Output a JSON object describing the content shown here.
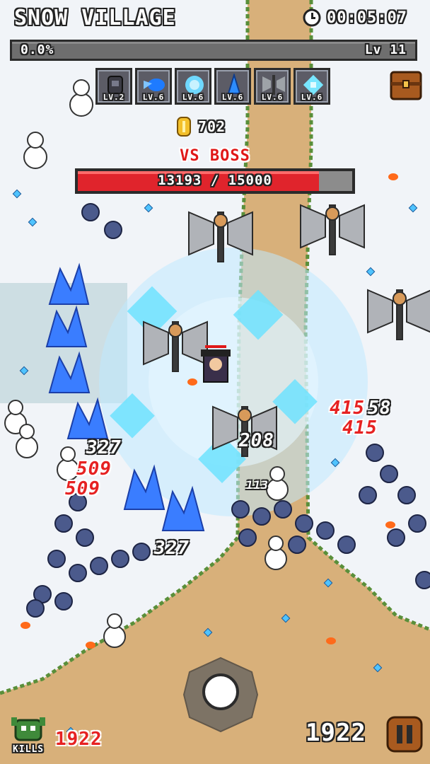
{
  "hud": {
    "stage_title": "SNOW VILLAGE",
    "timer": "00:05:07",
    "xp_percent_text": "0.0%",
    "xp_fraction": 0.0,
    "level_text": "Lv 11",
    "coins": "702",
    "boss_label": "VS BOSS",
    "boss_hp_text": "13193 / 15000",
    "boss_hp_fraction": 0.8795,
    "kills_label": "KILLS",
    "kills_count": "1922",
    "score": "1922"
  },
  "skills": [
    {
      "icon": "armor-icon",
      "level": "LV.2",
      "color": "#3b3b44"
    },
    {
      "icon": "fireball-icon",
      "level": "LV.6",
      "color": "#1e7bff"
    },
    {
      "icon": "ice-orb-icon",
      "level": "LV.6",
      "color": "#6fd8ff"
    },
    {
      "icon": "ice-crystal-icon",
      "level": "LV.6",
      "color": "#2c8cff"
    },
    {
      "icon": "battle-axe-icon",
      "level": "LV.6",
      "color": "#9ea3a8"
    },
    {
      "icon": "snowflake-icon",
      "level": "LV.6",
      "color": "#78e6ff"
    }
  ],
  "damage_numbers": [
    {
      "text": "415",
      "color": "red"
    },
    {
      "text": "58",
      "color": "white"
    },
    {
      "text": "415",
      "color": "red"
    },
    {
      "text": "327",
      "color": "white"
    },
    {
      "text": "509",
      "color": "red"
    },
    {
      "text": "509",
      "color": "red"
    },
    {
      "text": "327",
      "color": "white"
    },
    {
      "text": "208",
      "color": "white"
    },
    {
      "text": "113",
      "color": "white"
    }
  ],
  "colors": {
    "snow": "#f1f4f8",
    "path": "#d8b07a",
    "grass_edge": "#5a8f3a",
    "boss_bar": "#e0242c",
    "xp_fill": "#59c0ff",
    "damage_red": "#e62222"
  }
}
